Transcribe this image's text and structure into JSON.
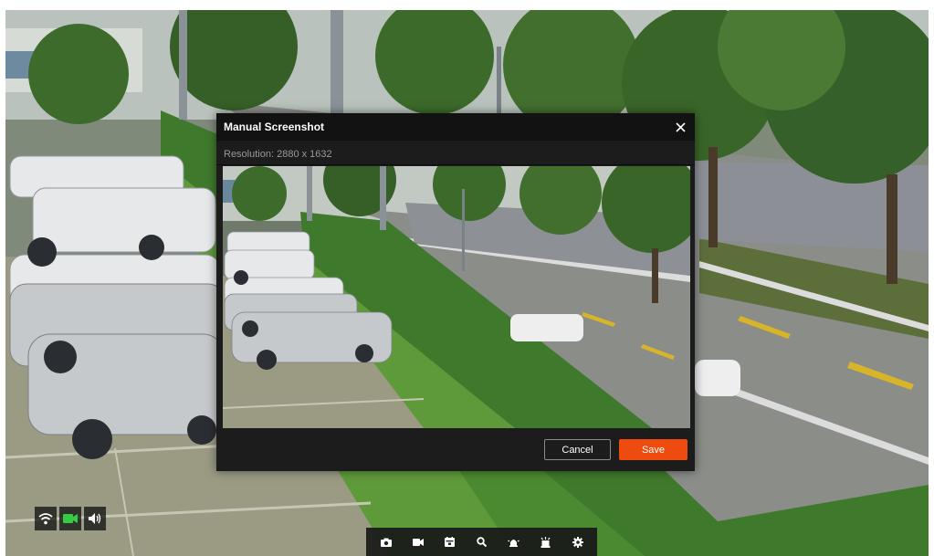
{
  "dialog": {
    "title": "Manual Screenshot",
    "resolution": "Resolution: 2880 x 1632",
    "cancel_label": "Cancel",
    "save_label": "Save",
    "close_icon": "close-icon"
  },
  "status_icons": [
    {
      "name": "wifi-icon",
      "color": "#ffffff"
    },
    {
      "name": "record-camera-icon",
      "color": "#33cc44"
    },
    {
      "name": "speaker-icon",
      "color": "#ffffff"
    }
  ],
  "toolbar": {
    "items": [
      {
        "name": "screenshot-camera-icon"
      },
      {
        "name": "record-video-icon"
      },
      {
        "name": "playback-calendar-icon"
      },
      {
        "name": "zoom-icon"
      },
      {
        "name": "alarm-siren-icon"
      },
      {
        "name": "light-icon"
      },
      {
        "name": "settings-gear-icon"
      }
    ]
  },
  "colors": {
    "save_button": "#ee4c0e",
    "dialog_background": "#1c1c1c",
    "record_active": "#33cc44"
  }
}
